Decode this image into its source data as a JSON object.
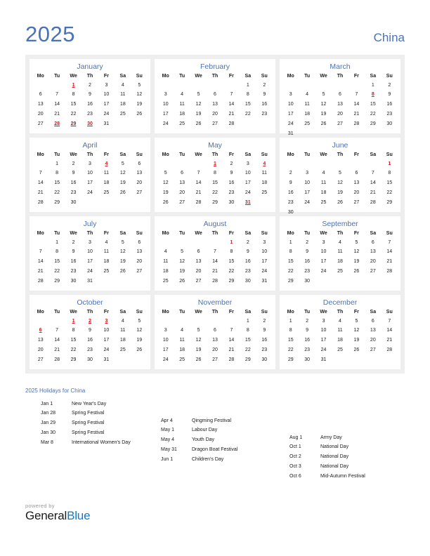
{
  "header": {
    "year": "2025",
    "country": "China"
  },
  "colors": {
    "accent_blue": "#4a72b8",
    "holiday_red": "#d4121a",
    "panel_bg": "#eeeeee",
    "logo_blue": "#1379c4"
  },
  "weekday_headers": [
    "Mo",
    "Tu",
    "We",
    "Th",
    "Fr",
    "Sa",
    "Su"
  ],
  "months": [
    {
      "name": "January",
      "weeks": [
        [
          "",
          "",
          "1",
          "2",
          "3",
          "4",
          "5"
        ],
        [
          "6",
          "7",
          "8",
          "9",
          "10",
          "11",
          "12"
        ],
        [
          "13",
          "14",
          "15",
          "16",
          "17",
          "18",
          "19"
        ],
        [
          "20",
          "21",
          "22",
          "23",
          "24",
          "25",
          "26"
        ],
        [
          "27",
          "28",
          "29",
          "30",
          "31",
          "",
          ""
        ],
        [
          "",
          "",
          "",
          "",
          "",
          "",
          ""
        ]
      ],
      "holidays": [
        "1",
        "28",
        "29",
        "30"
      ]
    },
    {
      "name": "February",
      "weeks": [
        [
          "",
          "",
          "",
          "",
          "",
          "1",
          "2"
        ],
        [
          "3",
          "4",
          "5",
          "6",
          "7",
          "8",
          "9"
        ],
        [
          "10",
          "11",
          "12",
          "13",
          "14",
          "15",
          "16"
        ],
        [
          "17",
          "18",
          "19",
          "20",
          "21",
          "22",
          "23"
        ],
        [
          "24",
          "25",
          "26",
          "27",
          "28",
          "",
          ""
        ],
        [
          "",
          "",
          "",
          "",
          "",
          "",
          ""
        ]
      ],
      "holidays": []
    },
    {
      "name": "March",
      "weeks": [
        [
          "",
          "",
          "",
          "",
          "",
          "1",
          "2"
        ],
        [
          "3",
          "4",
          "5",
          "6",
          "7",
          "8",
          "9"
        ],
        [
          "10",
          "11",
          "12",
          "13",
          "14",
          "15",
          "16"
        ],
        [
          "17",
          "18",
          "19",
          "20",
          "21",
          "22",
          "23"
        ],
        [
          "24",
          "25",
          "26",
          "27",
          "28",
          "29",
          "30"
        ],
        [
          "31",
          "",
          "",
          "",
          "",
          "",
          ""
        ]
      ],
      "holidays": [
        "8"
      ]
    },
    {
      "name": "April",
      "weeks": [
        [
          "",
          "1",
          "2",
          "3",
          "4",
          "5",
          "6"
        ],
        [
          "7",
          "8",
          "9",
          "10",
          "11",
          "12",
          "13"
        ],
        [
          "14",
          "15",
          "16",
          "17",
          "18",
          "19",
          "20"
        ],
        [
          "21",
          "22",
          "23",
          "24",
          "25",
          "26",
          "27"
        ],
        [
          "28",
          "29",
          "30",
          "",
          "",
          "",
          ""
        ],
        [
          "",
          "",
          "",
          "",
          "",
          "",
          ""
        ]
      ],
      "holidays": [
        "4"
      ]
    },
    {
      "name": "May",
      "weeks": [
        [
          "",
          "",
          "",
          "1",
          "2",
          "3",
          "4"
        ],
        [
          "5",
          "6",
          "7",
          "8",
          "9",
          "10",
          "11"
        ],
        [
          "12",
          "13",
          "14",
          "15",
          "16",
          "17",
          "18"
        ],
        [
          "19",
          "20",
          "21",
          "22",
          "23",
          "24",
          "25"
        ],
        [
          "26",
          "27",
          "28",
          "29",
          "30",
          "31",
          ""
        ],
        [
          "",
          "",
          "",
          "",
          "",
          "",
          ""
        ]
      ],
      "holidays": [
        "1",
        "4",
        "31"
      ]
    },
    {
      "name": "June",
      "weeks": [
        [
          "",
          "",
          "",
          "",
          "",
          "",
          "1"
        ],
        [
          "2",
          "3",
          "4",
          "5",
          "6",
          "7",
          "8"
        ],
        [
          "9",
          "10",
          "11",
          "12",
          "13",
          "14",
          "15"
        ],
        [
          "16",
          "17",
          "18",
          "19",
          "20",
          "21",
          "22"
        ],
        [
          "23",
          "24",
          "25",
          "26",
          "27",
          "28",
          "29"
        ],
        [
          "30",
          "",
          "",
          "",
          "",
          "",
          ""
        ]
      ],
      "holidays": [
        "1"
      ],
      "holidays_no_underline": [
        "1"
      ]
    },
    {
      "name": "July",
      "weeks": [
        [
          "",
          "1",
          "2",
          "3",
          "4",
          "5",
          "6"
        ],
        [
          "7",
          "8",
          "9",
          "10",
          "11",
          "12",
          "13"
        ],
        [
          "14",
          "15",
          "16",
          "17",
          "18",
          "19",
          "20"
        ],
        [
          "21",
          "22",
          "23",
          "24",
          "25",
          "26",
          "27"
        ],
        [
          "28",
          "29",
          "30",
          "31",
          "",
          "",
          ""
        ],
        [
          "",
          "",
          "",
          "",
          "",
          "",
          ""
        ]
      ],
      "holidays": []
    },
    {
      "name": "August",
      "weeks": [
        [
          "",
          "",
          "",
          "",
          "1",
          "2",
          "3"
        ],
        [
          "4",
          "5",
          "6",
          "7",
          "8",
          "9",
          "10"
        ],
        [
          "11",
          "12",
          "13",
          "14",
          "15",
          "16",
          "17"
        ],
        [
          "18",
          "19",
          "20",
          "21",
          "22",
          "23",
          "24"
        ],
        [
          "25",
          "26",
          "27",
          "28",
          "29",
          "30",
          "31"
        ],
        [
          "",
          "",
          "",
          "",
          "",
          "",
          ""
        ]
      ],
      "holidays": [
        "1"
      ],
      "holidays_no_underline": [
        "1"
      ]
    },
    {
      "name": "September",
      "weeks": [
        [
          "1",
          "2",
          "3",
          "4",
          "5",
          "6",
          "7"
        ],
        [
          "8",
          "9",
          "10",
          "11",
          "12",
          "13",
          "14"
        ],
        [
          "15",
          "16",
          "17",
          "18",
          "19",
          "20",
          "21"
        ],
        [
          "22",
          "23",
          "24",
          "25",
          "26",
          "27",
          "28"
        ],
        [
          "29",
          "30",
          "",
          "",
          "",
          "",
          ""
        ],
        [
          "",
          "",
          "",
          "",
          "",
          "",
          ""
        ]
      ],
      "holidays": []
    },
    {
      "name": "October",
      "weeks": [
        [
          "",
          "",
          "1",
          "2",
          "3",
          "4",
          "5"
        ],
        [
          "6",
          "7",
          "8",
          "9",
          "10",
          "11",
          "12"
        ],
        [
          "13",
          "14",
          "15",
          "16",
          "17",
          "18",
          "19"
        ],
        [
          "20",
          "21",
          "22",
          "23",
          "24",
          "25",
          "26"
        ],
        [
          "27",
          "28",
          "29",
          "30",
          "31",
          "",
          ""
        ],
        [
          "",
          "",
          "",
          "",
          "",
          "",
          ""
        ]
      ],
      "holidays": [
        "1",
        "2",
        "3",
        "6"
      ]
    },
    {
      "name": "November",
      "weeks": [
        [
          "",
          "",
          "",
          "",
          "",
          "1",
          "2"
        ],
        [
          "3",
          "4",
          "5",
          "6",
          "7",
          "8",
          "9"
        ],
        [
          "10",
          "11",
          "12",
          "13",
          "14",
          "15",
          "16"
        ],
        [
          "17",
          "18",
          "19",
          "20",
          "21",
          "22",
          "23"
        ],
        [
          "24",
          "25",
          "26",
          "27",
          "28",
          "29",
          "30"
        ],
        [
          "",
          "",
          "",
          "",
          "",
          "",
          ""
        ]
      ],
      "holidays": []
    },
    {
      "name": "December",
      "weeks": [
        [
          "1",
          "2",
          "3",
          "4",
          "5",
          "6",
          "7"
        ],
        [
          "8",
          "9",
          "10",
          "11",
          "12",
          "13",
          "14"
        ],
        [
          "15",
          "16",
          "17",
          "18",
          "19",
          "20",
          "21"
        ],
        [
          "22",
          "23",
          "24",
          "25",
          "26",
          "27",
          "28"
        ],
        [
          "29",
          "30",
          "31",
          "",
          "",
          "",
          ""
        ],
        [
          "",
          "",
          "",
          "",
          "",
          "",
          ""
        ]
      ],
      "holidays": []
    }
  ],
  "holidays_section": {
    "heading": "2025 Holidays for China",
    "columns": [
      [
        {
          "date": "Jan 1",
          "name": "New Year's Day"
        },
        {
          "date": "Jan 28",
          "name": "Spring Festival"
        },
        {
          "date": "Jan 29",
          "name": "Spring Festival"
        },
        {
          "date": "Jan 30",
          "name": "Spring Festival"
        },
        {
          "date": "Mar 8",
          "name": "International Women's Day"
        }
      ],
      [
        {
          "date": "Apr 4",
          "name": "Qingming Festival"
        },
        {
          "date": "May 1",
          "name": "Labour Day"
        },
        {
          "date": "May 4",
          "name": "Youth Day"
        },
        {
          "date": "May 31",
          "name": "Dragon Boat Festival"
        },
        {
          "date": "Jun 1",
          "name": "Children's Day"
        }
      ],
      [
        {
          "date": "Aug 1",
          "name": "Army Day"
        },
        {
          "date": "Oct 1",
          "name": "National Day"
        },
        {
          "date": "Oct 2",
          "name": "National Day"
        },
        {
          "date": "Oct 3",
          "name": "National Day"
        },
        {
          "date": "Oct 6",
          "name": "Mid-Autumn Festival"
        }
      ]
    ]
  },
  "footer": {
    "powered_by": "powered by",
    "logo_part1": "General",
    "logo_part2": "Blue"
  }
}
